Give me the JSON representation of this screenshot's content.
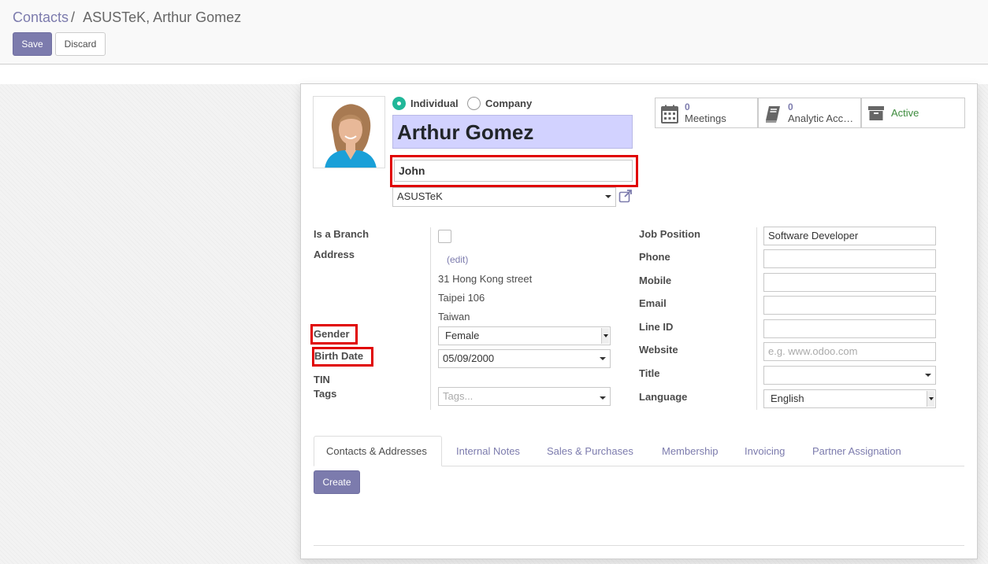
{
  "breadcrumb": {
    "parent": "Contacts",
    "separator": "/",
    "current": "ASUSTeK, Arthur Gomez"
  },
  "buttons": {
    "save": "Save",
    "discard": "Discard"
  },
  "company_type": {
    "individual": "Individual",
    "company": "Company",
    "selected": "Individual"
  },
  "contact": {
    "name": "Arthur Gomez",
    "middle_name": "John",
    "parent_company": "ASUSTeK"
  },
  "stat_buttons": {
    "meetings": {
      "count": "0",
      "label": "Meetings"
    },
    "analytic": {
      "count": "0",
      "label": "Analytic Acc…"
    },
    "active": {
      "label": "Active"
    }
  },
  "left_fields": {
    "is_branch": {
      "label": "Is a Branch",
      "checked": false
    },
    "address": {
      "label": "Address",
      "edit_link": "(edit)",
      "lines": [
        "31 Hong Kong street",
        "Taipei 106",
        "Taiwan"
      ]
    },
    "gender": {
      "label": "Gender",
      "value": "Female"
    },
    "birth_date": {
      "label": "Birth Date",
      "value": "05/09/2000"
    },
    "tin": {
      "label": "TIN"
    },
    "tags": {
      "label": "Tags",
      "placeholder": "Tags..."
    }
  },
  "right_fields": {
    "job_position": {
      "label": "Job Position",
      "value": "Software Developer"
    },
    "phone": {
      "label": "Phone",
      "value": ""
    },
    "mobile": {
      "label": "Mobile",
      "value": ""
    },
    "email": {
      "label": "Email",
      "value": ""
    },
    "line_id": {
      "label": "Line ID",
      "value": ""
    },
    "website": {
      "label": "Website",
      "placeholder": "e.g. www.odoo.com"
    },
    "title": {
      "label": "Title",
      "value": ""
    },
    "language": {
      "label": "Language",
      "value": "English"
    }
  },
  "tabs": [
    {
      "label": "Contacts & Addresses",
      "active": true
    },
    {
      "label": "Internal Notes",
      "active": false
    },
    {
      "label": "Sales & Purchases",
      "active": false
    },
    {
      "label": "Membership",
      "active": false
    },
    {
      "label": "Invoicing",
      "active": false
    },
    {
      "label": "Partner Assignation",
      "active": false
    }
  ],
  "create_button": "Create",
  "colors": {
    "primary": "#7c7bad",
    "highlight": "#e00000",
    "name_bg": "#d2d2ff",
    "active_green": "#21b799"
  },
  "annotations": [
    "middle-name-field",
    "gender-label",
    "birth-date-label"
  ]
}
